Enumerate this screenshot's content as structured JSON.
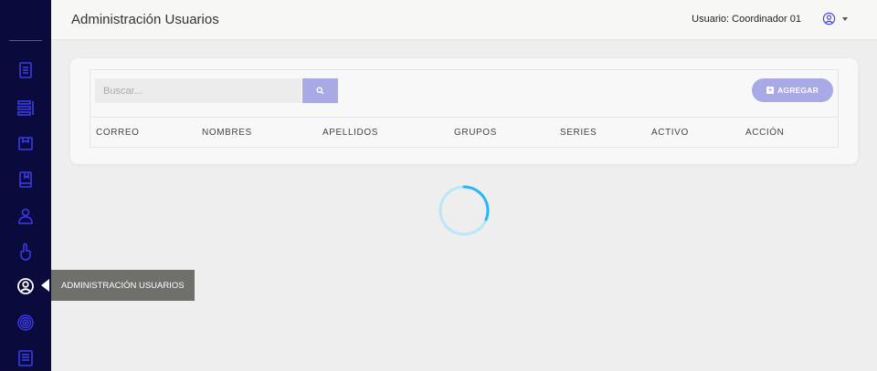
{
  "header": {
    "title": "Administración Usuarios",
    "user_label": "Usuario: Coordinador 01"
  },
  "toolbar": {
    "search_placeholder": "Buscar...",
    "add_label": "AGREGAR"
  },
  "table": {
    "columns": [
      "CORREO",
      "NOMBRES",
      "APELLIDOS",
      "GRUPOS",
      "SERIES",
      "ACTIVO",
      "ACCIÓN"
    ]
  },
  "sidebar": {
    "tooltip": "ADMINISTRACIÓN USUARIOS",
    "items": [
      "document-icon",
      "list-icon",
      "box-icon",
      "book-icon",
      "user-icon",
      "pointer-icon",
      "user-circle-icon",
      "fingerprint-icon",
      "report-icon"
    ]
  },
  "colors": {
    "sidebar": "#0a0a3d",
    "sidebar_icon": "#3b3be6",
    "accent": "#a9a9e6",
    "spinner": "#29b6f6"
  }
}
